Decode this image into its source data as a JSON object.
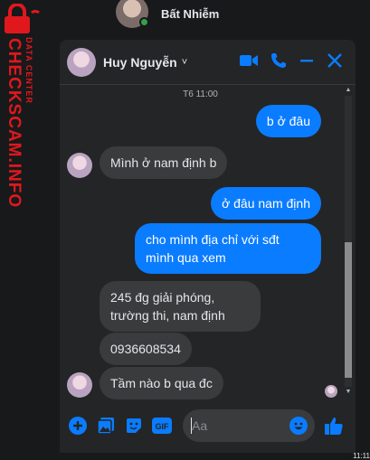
{
  "watermark": {
    "main": "CHECKSCAM.INFO",
    "sub": "DATA CENTER"
  },
  "top_contact": {
    "name": "Bất Nhiễm"
  },
  "chat": {
    "name": "Huy Nguyễn",
    "chevron": "˅",
    "timestamp": "T6 11:00",
    "messages": [
      {
        "from": "me",
        "text": "b ở đâu"
      },
      {
        "from": "them",
        "text": "Mình ở nam định b"
      },
      {
        "from": "me",
        "text": "ở đâu nam định"
      },
      {
        "from": "me",
        "text": "cho mình địa chỉ với sđt mình qua xem"
      },
      {
        "from": "them",
        "text": "245 đg giải phóng, trường thi, nam định"
      },
      {
        "from": "them",
        "text": "0936608534"
      },
      {
        "from": "them",
        "text": "Tầm nào b qua đc"
      }
    ],
    "composer": {
      "placeholder": "Aa"
    }
  },
  "colors": {
    "accent": "#0a7cff",
    "background": "#18191a",
    "panel": "#242526",
    "bubble_in": "#3a3b3c",
    "watermark": "#e0181e"
  },
  "icons": [
    "video-call-icon",
    "phone-icon",
    "minimize-icon",
    "close-icon",
    "add-icon",
    "image-icon",
    "sticker-icon",
    "gif-icon",
    "emoji-icon",
    "like-icon"
  ],
  "corner_time": "11:11"
}
